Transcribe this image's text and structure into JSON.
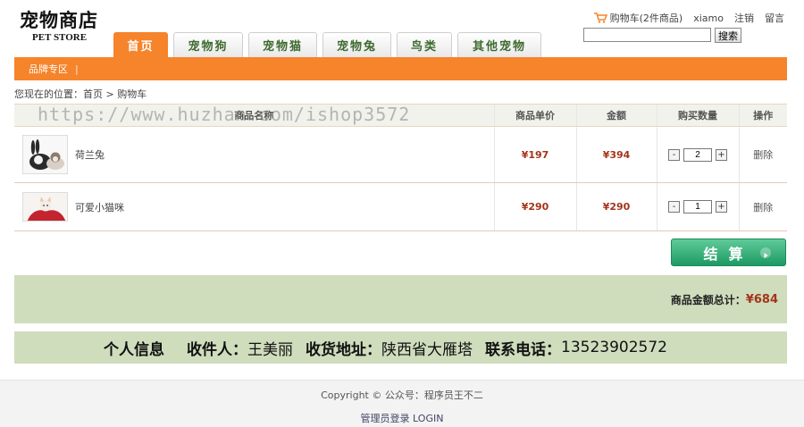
{
  "logo": {
    "cn": "宠物商店",
    "en": "PET STORE"
  },
  "nav": {
    "tabs": [
      {
        "label": "首页",
        "active": true
      },
      {
        "label": "宠物狗"
      },
      {
        "label": "宠物猫"
      },
      {
        "label": "宠物兔"
      },
      {
        "label": "鸟类"
      },
      {
        "label": "其他宠物"
      }
    ]
  },
  "top_links": {
    "cart": "购物车(2件商品)",
    "user": "xiamo",
    "logout": "注销",
    "message": "留言"
  },
  "search": {
    "value": "",
    "button": "搜索"
  },
  "subnav": {
    "brand_zone": "品牌专区",
    "sep": "|"
  },
  "breadcrumb": {
    "prefix": "您现在的位置：",
    "home": "首页",
    "sep": ">",
    "current": "购物车"
  },
  "watermark": "https://www.huzhan.com/ishop3572",
  "table": {
    "headers": {
      "product": "商品名称",
      "price": "商品单价",
      "amount": "金额",
      "qty": "购买数量",
      "op": "操作"
    },
    "rows": [
      {
        "name": "荷兰兔",
        "price": "¥197",
        "amount": "¥394",
        "qty": "2",
        "minus": "-",
        "plus": "+",
        "op": "删除"
      },
      {
        "name": "可爱小猫咪",
        "price": "¥290",
        "amount": "¥290",
        "qty": "1",
        "minus": "-",
        "plus": "+",
        "op": "删除"
      }
    ]
  },
  "checkout": {
    "label": "结算"
  },
  "total": {
    "label": "商品金额总计：",
    "value": "¥684"
  },
  "info": {
    "title": "个人信息",
    "receiver_label": "收件人：",
    "receiver": "王美丽",
    "address_label": "收货地址：",
    "address": "陕西省大雁塔",
    "phone_label": "联系电话：",
    "phone": "13523902572"
  },
  "footer": {
    "copyright": "Copyright © 公众号：程序员王不二",
    "admin": "管理员登录 LOGIN"
  },
  "colors": {
    "accent": "#f5842b",
    "price": "#a4341a",
    "panel": "#cfddbd",
    "checkout": "#1e9a63"
  }
}
